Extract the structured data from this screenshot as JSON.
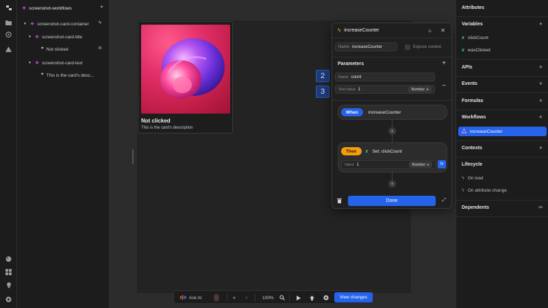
{
  "tree": {
    "root_label": "screenshot-workflows",
    "items": [
      {
        "label": "screenshot-card-container"
      },
      {
        "label": "screenshot-card-title"
      },
      {
        "label": "Not clicked"
      },
      {
        "label": "screenshot-card-text"
      },
      {
        "label": "This is the card's desc..."
      }
    ]
  },
  "card": {
    "title": "Not clicked",
    "description": "This is the card's description"
  },
  "popup": {
    "title": "increaseCounter",
    "name_label": "Name",
    "name_value": "increaseCounter",
    "expose_label": "Expose context",
    "parameters_label": "Parameters",
    "param_name_label": "Name",
    "param_name_value": "count",
    "test_value_label": "Test value",
    "test_value": "1",
    "test_type": "Number",
    "when_label": "When",
    "when_value": "increaseCounter",
    "then_label": "Then",
    "then_action": "Set: clickCount",
    "then_value_label": "Value",
    "then_value": "1",
    "then_type": "Number",
    "fx_label": "fx",
    "done_label": "Done",
    "badges": [
      "1",
      "2",
      "3"
    ]
  },
  "right_panel": {
    "attributes": "Attributes",
    "variables": "Variables",
    "variable_items": [
      "clickCount",
      "wasClicked"
    ],
    "apis": "APIs",
    "events": "Events",
    "formulas": "Formulas",
    "workflows": "Workflows",
    "workflow_items": [
      "increaseCounter"
    ],
    "contexts": "Contexts",
    "lifecycle": "Lifecycle",
    "lifecycle_items": [
      "On load",
      "On attribute change"
    ],
    "dependents": "Dependents"
  },
  "toolbar": {
    "ask_ai": "Ask AI",
    "zoom": "100%",
    "view_changes": "View changes"
  },
  "colors": {
    "accent": "#2563eb",
    "component": "#c14ad6",
    "variable": "#4ec98d",
    "then": "#f59e0b"
  }
}
